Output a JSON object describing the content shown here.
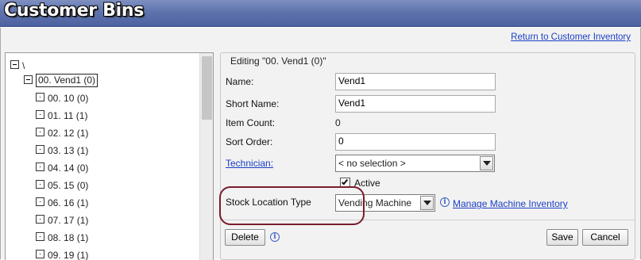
{
  "header": {
    "title": "Customer Bins"
  },
  "return_link": "Return to Customer Inventory",
  "tree": {
    "root": "\\",
    "selected": "00. Vend1 (0)",
    "children": [
      "00. 10 (0)",
      "01. 11 (1)",
      "02. 12 (1)",
      "03. 13 (1)",
      "04. 14 (0)",
      "05. 15 (0)",
      "06. 16 (1)",
      "07. 17 (1)",
      "08. 18 (1)",
      "09. 19 (1)"
    ]
  },
  "form": {
    "legend": "Editing \"00. Vend1 (0)\"",
    "name_label": "Name:",
    "name_value": "Vend1",
    "short_name_label": "Short Name:",
    "short_name_value": "Vend1",
    "item_count_label": "Item Count:",
    "item_count_value": "0",
    "sort_order_label": "Sort Order:",
    "sort_order_value": "0",
    "technician_label": "Technician:",
    "technician_value": "< no selection >",
    "active_label": "Active",
    "stock_location_label": "Stock Location Type",
    "stock_location_value": "Vending Machine",
    "manage_link": "Manage Machine Inventory",
    "delete_label": "Delete",
    "save_label": "Save",
    "cancel_label": "Cancel"
  },
  "colors": {
    "header": "#5f74ad",
    "link": "#1a3fc4",
    "highlight": "#7a1c2c"
  }
}
